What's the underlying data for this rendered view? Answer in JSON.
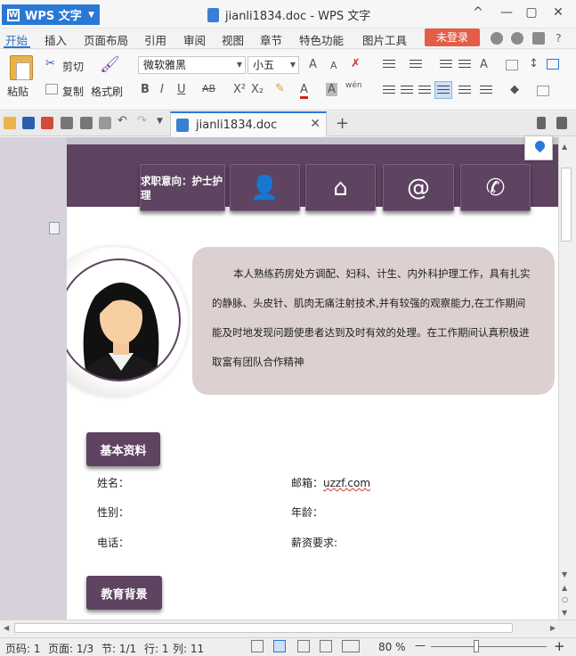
{
  "titlebar": {
    "app_name": "WPS 文字",
    "window_title": "jianli1834.doc - WPS 文字",
    "minimize_glyph": "—",
    "restore_glyph": "▢",
    "close_glyph": "✕",
    "collapse_glyph": "^"
  },
  "menu": {
    "items": [
      "开始",
      "插入",
      "页面布局",
      "引用",
      "审阅",
      "视图",
      "章节",
      "特色功能",
      "图片工具"
    ],
    "login_label": "未登录",
    "help_label": "?"
  },
  "ribbon": {
    "paste_label": "粘贴",
    "cut_label": "剪切",
    "copy_label": "复制",
    "format_painter_label": "格式刷",
    "font_name": "微软雅黑",
    "font_size": "小五",
    "bold": "B",
    "italic": "I",
    "underline": "U",
    "strikethrough": "AB",
    "superscript": "X²",
    "subscript": "X₂",
    "font_color": "A",
    "wen_label": "wén"
  },
  "doc_tab": {
    "label": "jianli1834.doc",
    "close": "✕",
    "new_tab": "+"
  },
  "document": {
    "job_intent_label": "求职意向：护士护理",
    "contact_icons": [
      "person-icon",
      "home-icon",
      "at-icon",
      "phone-icon"
    ],
    "contact_glyphs": [
      "👤",
      "⌂",
      "@",
      "✆"
    ],
    "profile_text": "本人熟练药房处方调配、妇科、计生、内外科护理工作，具有扎实的静脉、头皮针、肌肉无痛注射技术,并有较强的观察能力,在工作期间能及时地发现问题使患者达到及时有效的处理。在工作期间认真积极进取富有团队合作精神",
    "basic_info_title": "基本资料",
    "fields": {
      "name_label": "姓名：",
      "gender_label": "性别：",
      "phone_label": "电话：",
      "email_label": "邮箱：",
      "email_value": "uzzf.com",
      "age_label": "年龄：",
      "salary_label": "薪资要求:"
    },
    "education_title": "教育背景"
  },
  "statusbar": {
    "page_code": "页码: 1",
    "pages": "页面: 1/3",
    "section": "节: 1/1",
    "row": "行: 1",
    "column": "列: 11",
    "zoom": "80 %",
    "zoom_fraction": 0.4
  },
  "colors": {
    "accent": "#2a78d6",
    "banner": "#5e4461",
    "bubble": "#dcd1d0",
    "login": "#e45d48"
  }
}
